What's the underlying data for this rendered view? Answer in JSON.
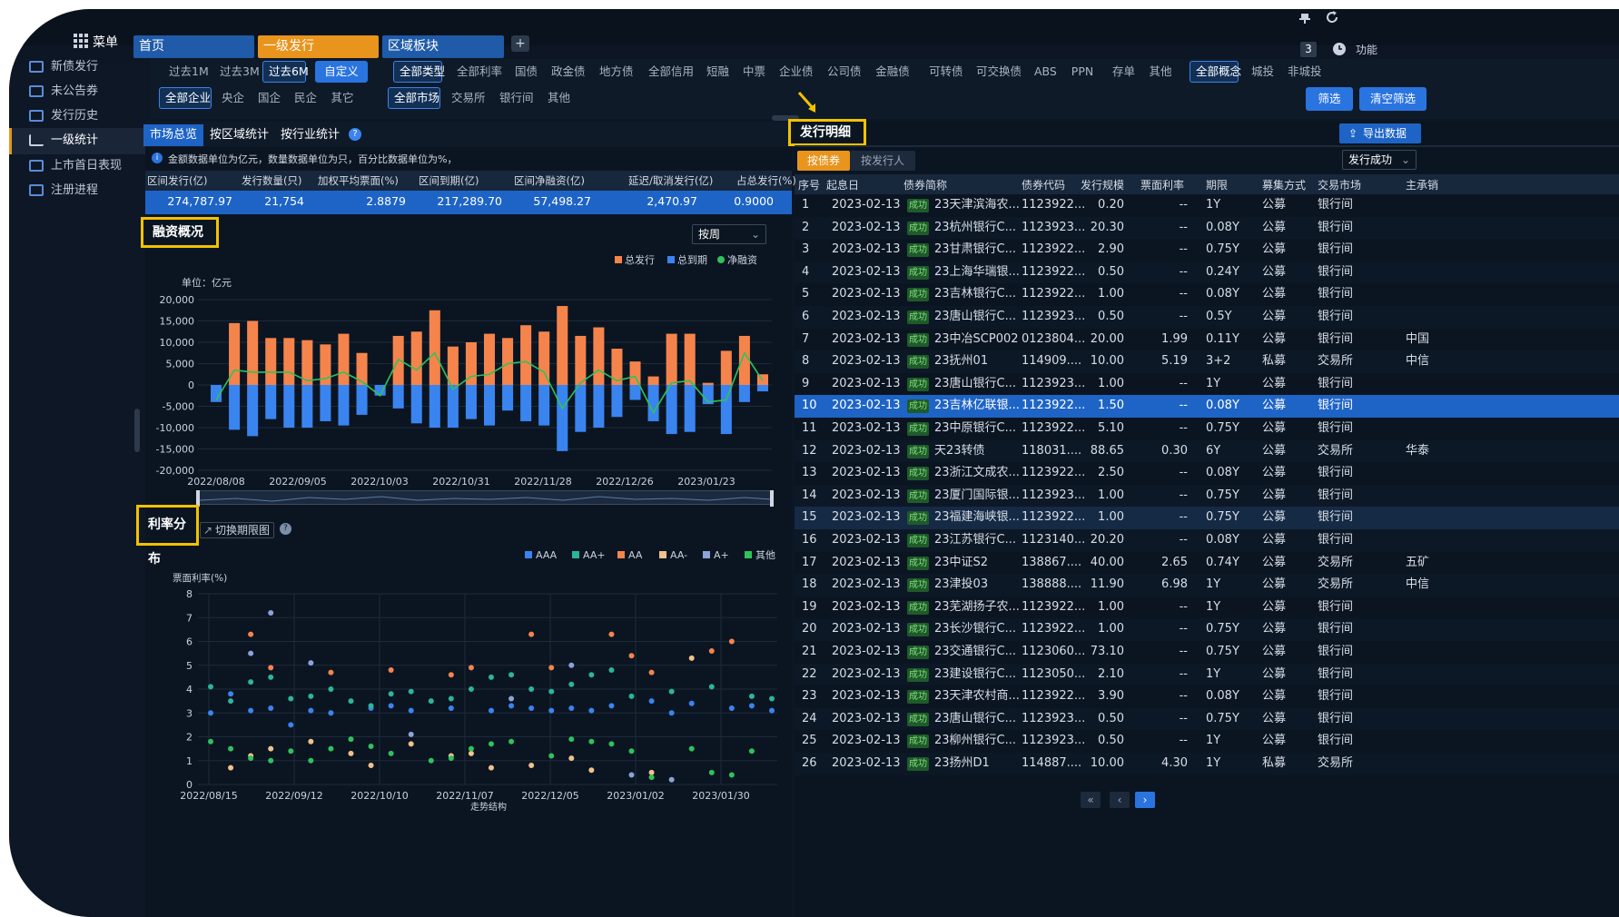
{
  "topbar": {
    "menu_label": "菜单",
    "tabs": [
      "首页",
      "一级发行",
      "区域板块"
    ],
    "add": "+",
    "count": "3",
    "func_label": "功能"
  },
  "sidebar": {
    "items": [
      "新债发行",
      "未公告券",
      "发行历史",
      "一级统计",
      "上市首日表现",
      "注册进程"
    ],
    "active": 3
  },
  "filters": {
    "row1": [
      "过去1M",
      "过去3M",
      "过去6M",
      "自定义",
      "全部类型",
      "全部利率",
      "国债",
      "政金债",
      "地方债",
      "全部信用",
      "短融",
      "中票",
      "企业债",
      "公司债",
      "金融债",
      "可转债",
      "可交换债",
      "ABS",
      "PPN",
      "存单",
      "其他",
      "全部概念",
      "城投",
      "非城投"
    ],
    "row2": [
      "全部企业",
      "央企",
      "国企",
      "民企",
      "其它",
      "全部市场",
      "交易所",
      "银行间",
      "其他"
    ],
    "screen_button": "筛选",
    "clear_button": "清空筛选"
  },
  "left": {
    "tabs": [
      "市场总览",
      "按区域统计",
      "按行业统计"
    ],
    "notice": "金额数据单位为亿元，数量数据单位为只，百分比数据单位为%，",
    "summary_headers": [
      "区间发行(亿)",
      "发行数量(只)",
      "加权平均票面(%)",
      "区间到期(亿)",
      "区间净融资(亿)",
      "延迟/取消发行(亿)",
      "占总发行(%)"
    ],
    "summary_values": [
      "274,787.97",
      "21,754",
      "2.8879",
      "217,289.70",
      "57,498.27",
      "2,470.97",
      "0.9000"
    ],
    "financing_title": "融资概况",
    "period_select": "按周",
    "rate_title": "利率分布",
    "switch_term": "切换期限图"
  },
  "chart_data": [
    {
      "type": "bar",
      "title": "",
      "unit": "单位：亿元",
      "legend": [
        "总发行",
        "总到期",
        "净融资"
      ],
      "colors": {
        "总发行": "#f5844c",
        "总到期": "#3a84f0",
        "净融资": "#2fc25b"
      },
      "x_ticks": [
        "2022/08/08",
        "2022/09/05",
        "2022/10/03",
        "2022/10/31",
        "2022/11/28",
        "2022/12/26",
        "2023/01/23"
      ],
      "ylim": [
        -20000,
        20000
      ],
      "y_ticks": [
        "20,000",
        "15,000",
        "10,000",
        "5,000",
        "0",
        "-5,000",
        "-10,000",
        "-15,000",
        "-20,000"
      ],
      "series": [
        {
          "name": "总发行",
          "values": [
            0,
            14500,
            15000,
            11000,
            11000,
            10500,
            9500,
            12000,
            7500,
            0,
            11500,
            12500,
            17500,
            9000,
            10000,
            12000,
            11000,
            14000,
            12500,
            18500,
            11500,
            13500,
            8500,
            5500,
            2000,
            12000,
            12000,
            500,
            8000,
            11500,
            2500
          ]
        },
        {
          "name": "总到期",
          "values": [
            -4000,
            -10500,
            -12000,
            -8000,
            -10000,
            -10000,
            -8500,
            -9500,
            -7000,
            -2500,
            -5500,
            -9000,
            -10000,
            -10000,
            -8000,
            -9500,
            -6000,
            -8500,
            -9500,
            -15500,
            -11000,
            -10000,
            -7500,
            -3500,
            -8500,
            -11500,
            -11000,
            -4500,
            -11500,
            -4000,
            -1500
          ]
        },
        {
          "name": "净融资",
          "values": [
            -3500,
            3500,
            3000,
            3000,
            3000,
            1000,
            1500,
            3000,
            800,
            -2500,
            6000,
            3500,
            7500,
            -1000,
            2000,
            2500,
            5000,
            5500,
            3000,
            -5500,
            500,
            3500,
            1000,
            2000,
            -6500,
            500,
            1000,
            -4000,
            -3500,
            7500,
            1000
          ]
        }
      ]
    },
    {
      "type": "scatter",
      "ylabel": "票面利率(%)",
      "xlabel": "走势结构",
      "x_ticks": [
        "2022/08/15",
        "2022/09/12",
        "2022/10/10",
        "2022/11/07",
        "2022/12/05",
        "2023/01/02",
        "2023/01/30"
      ],
      "ylim": [
        0,
        8
      ],
      "legend": [
        "AAA",
        "AA+",
        "AA",
        "AA-",
        "A+",
        "其他"
      ],
      "colors": {
        "AAA": "#3a84f0",
        "AA+": "#2bb59c",
        "AA": "#f5844c",
        "AA-": "#f0c28c",
        "A+": "#8aa3d8",
        "其他": "#2fc25b"
      },
      "series": [
        {
          "name": "AAA",
          "points": [
            [
              0,
              3
            ],
            [
              1,
              3.8
            ],
            [
              2,
              3.1
            ],
            [
              3,
              3.2
            ],
            [
              4,
              2.5
            ],
            [
              5,
              3.1
            ],
            [
              6,
              3
            ],
            [
              8,
              3.2
            ],
            [
              9,
              3.3
            ],
            [
              10,
              3.1
            ],
            [
              12,
              3.2
            ],
            [
              14,
              3.1
            ],
            [
              15,
              3.3
            ],
            [
              16,
              3.2
            ],
            [
              17,
              3.1
            ],
            [
              18,
              3.2
            ],
            [
              19,
              3.1
            ],
            [
              20,
              3.3
            ],
            [
              22,
              3.5
            ],
            [
              23,
              3
            ],
            [
              24,
              3.4
            ],
            [
              26,
              3.2
            ],
            [
              27,
              3.3
            ],
            [
              28,
              3.1
            ]
          ]
        },
        {
          "name": "AA+",
          "points": [
            [
              0,
              4.1
            ],
            [
              1,
              3.5
            ],
            [
              2,
              4.3
            ],
            [
              3,
              4.5
            ],
            [
              4,
              3.6
            ],
            [
              5,
              3.7
            ],
            [
              6,
              4
            ],
            [
              7,
              3.5
            ],
            [
              8,
              3.3
            ],
            [
              9,
              3.8
            ],
            [
              10,
              3.9
            ],
            [
              11,
              3.5
            ],
            [
              12,
              3.6
            ],
            [
              13,
              4
            ],
            [
              14,
              4.5
            ],
            [
              15,
              4.6
            ],
            [
              16,
              4
            ],
            [
              17,
              3.9
            ],
            [
              18,
              4.2
            ],
            [
              19,
              4.6
            ],
            [
              20,
              4.8
            ],
            [
              21,
              3.7
            ],
            [
              23,
              3.9
            ],
            [
              25,
              4.1
            ],
            [
              27,
              3.7
            ],
            [
              28,
              3.6
            ]
          ]
        },
        {
          "name": "AA",
          "points": [
            [
              2,
              6.3
            ],
            [
              3,
              4.9
            ],
            [
              6,
              4.7
            ],
            [
              9,
              4.8
            ],
            [
              12,
              4.6
            ],
            [
              13,
              4.9
            ],
            [
              16,
              6.3
            ],
            [
              17,
              4.9
            ],
            [
              20,
              6.3
            ],
            [
              21,
              5.4
            ],
            [
              22,
              4.7
            ],
            [
              25,
              5.6
            ],
            [
              26,
              6
            ]
          ]
        },
        {
          "name": "AA-",
          "points": [
            [
              1,
              0.7
            ],
            [
              2,
              1.2
            ],
            [
              3,
              1.5
            ],
            [
              5,
              1.8
            ],
            [
              7,
              1.3
            ],
            [
              8,
              0.8
            ],
            [
              10,
              1.7
            ],
            [
              12,
              1.2
            ],
            [
              13,
              1.3
            ],
            [
              14,
              0.7
            ],
            [
              16,
              0.8
            ],
            [
              18,
              1.1
            ],
            [
              19,
              0.6
            ],
            [
              22,
              0.5
            ],
            [
              24,
              5.3
            ]
          ]
        },
        {
          "name": "A+",
          "points": [
            [
              2,
              5.5
            ],
            [
              3,
              7.2
            ],
            [
              5,
              5.1
            ],
            [
              10,
              2.1
            ],
            [
              15,
              3.6
            ],
            [
              18,
              5
            ],
            [
              21,
              0.4
            ],
            [
              23,
              0.2
            ]
          ]
        },
        {
          "name": "其他",
          "points": [
            [
              0,
              1.8
            ],
            [
              1,
              1.5
            ],
            [
              2,
              1.1
            ],
            [
              3,
              1.0
            ],
            [
              4,
              1.4
            ],
            [
              5,
              1.0
            ],
            [
              6,
              1.5
            ],
            [
              7,
              1.9
            ],
            [
              8,
              1.6
            ],
            [
              9,
              1.3
            ],
            [
              11,
              1.0
            ],
            [
              12,
              1.1
            ],
            [
              13,
              1.5
            ],
            [
              14,
              1.7
            ],
            [
              15,
              1.8
            ],
            [
              17,
              1.2
            ],
            [
              18,
              1.9
            ],
            [
              19,
              1.8
            ],
            [
              20,
              1.7
            ],
            [
              21,
              1.4
            ],
            [
              22,
              0.3
            ],
            [
              24,
              1.5
            ],
            [
              25,
              0.5
            ],
            [
              26,
              0.4
            ],
            [
              27,
              1.4
            ]
          ]
        }
      ]
    }
  ],
  "right": {
    "detail_title": "发行明细",
    "export_button": "导出数据",
    "subtabs": [
      "按债券",
      "按发行人"
    ],
    "status_select": "发行成功",
    "headers": [
      "序号",
      "起息日",
      "债券简称",
      "债券代码",
      "发行规模",
      "票面利率",
      "期限",
      "募集方式",
      "交易市场",
      "主承销"
    ],
    "status_label": "成功",
    "selected_row": 10,
    "rows": [
      [
        "1",
        "2023-02-13",
        "23天津滨海农...",
        "1123922...",
        "0.20",
        "--",
        "1Y",
        "公募",
        "银行间",
        ""
      ],
      [
        "2",
        "2023-02-13",
        "23杭州银行C...",
        "1123923...",
        "20.30",
        "--",
        "0.08Y",
        "公募",
        "银行间",
        ""
      ],
      [
        "3",
        "2023-02-13",
        "23甘肃银行C...",
        "1123922...",
        "2.90",
        "--",
        "0.75Y",
        "公募",
        "银行间",
        ""
      ],
      [
        "4",
        "2023-02-13",
        "23上海华瑞银...",
        "1123922...",
        "0.50",
        "--",
        "0.24Y",
        "公募",
        "银行间",
        ""
      ],
      [
        "5",
        "2023-02-13",
        "23吉林银行C...",
        "1123922...",
        "1.00",
        "--",
        "0.08Y",
        "公募",
        "银行间",
        ""
      ],
      [
        "6",
        "2023-02-13",
        "23唐山银行C...",
        "1123923...",
        "0.50",
        "--",
        "0.5Y",
        "公募",
        "银行间",
        ""
      ],
      [
        "7",
        "2023-02-13",
        "23中冶SCP002",
        "0123804...",
        "20.00",
        "1.99",
        "0.11Y",
        "公募",
        "银行间",
        "中国"
      ],
      [
        "8",
        "2023-02-13",
        "23抚州01",
        "114909....",
        "10.00",
        "5.19",
        "3+2",
        "私募",
        "交易所",
        "中信"
      ],
      [
        "9",
        "2023-02-13",
        "23唐山银行C...",
        "1123923...",
        "1.00",
        "--",
        "1Y",
        "公募",
        "银行间",
        ""
      ],
      [
        "10",
        "2023-02-13",
        "23吉林亿联银...",
        "1123922...",
        "1.50",
        "--",
        "0.08Y",
        "公募",
        "银行间",
        ""
      ],
      [
        "11",
        "2023-02-13",
        "23中原银行C...",
        "1123922...",
        "5.10",
        "--",
        "0.75Y",
        "公募",
        "银行间",
        ""
      ],
      [
        "12",
        "2023-02-13",
        "天23转债",
        "118031....",
        "88.65",
        "0.30",
        "6Y",
        "公募",
        "交易所",
        "华泰"
      ],
      [
        "13",
        "2023-02-13",
        "23浙江文成农...",
        "1123922...",
        "2.50",
        "--",
        "0.08Y",
        "公募",
        "银行间",
        ""
      ],
      [
        "14",
        "2023-02-13",
        "23厦门国际银...",
        "1123923...",
        "1.00",
        "--",
        "0.75Y",
        "公募",
        "银行间",
        ""
      ],
      [
        "15",
        "2023-02-13",
        "23福建海峡银...",
        "1123922...",
        "1.00",
        "--",
        "0.75Y",
        "公募",
        "银行间",
        ""
      ],
      [
        "16",
        "2023-02-13",
        "23江苏银行C...",
        "1123140...",
        "20.20",
        "--",
        "0.08Y",
        "公募",
        "银行间",
        ""
      ],
      [
        "17",
        "2023-02-13",
        "23中证S2",
        "138867....",
        "40.00",
        "2.65",
        "0.74Y",
        "公募",
        "交易所",
        "五矿"
      ],
      [
        "18",
        "2023-02-13",
        "23津投03",
        "138888....",
        "11.90",
        "6.98",
        "1Y",
        "公募",
        "交易所",
        "中信"
      ],
      [
        "19",
        "2023-02-13",
        "23芜湖扬子农...",
        "1123922...",
        "1.00",
        "--",
        "1Y",
        "公募",
        "银行间",
        ""
      ],
      [
        "20",
        "2023-02-13",
        "23长沙银行C...",
        "1123922...",
        "1.00",
        "--",
        "0.75Y",
        "公募",
        "银行间",
        ""
      ],
      [
        "21",
        "2023-02-13",
        "23交通银行C...",
        "1123060...",
        "73.10",
        "--",
        "0.75Y",
        "公募",
        "银行间",
        ""
      ],
      [
        "22",
        "2023-02-13",
        "23建设银行C...",
        "1123050...",
        "2.10",
        "--",
        "1Y",
        "公募",
        "银行间",
        ""
      ],
      [
        "23",
        "2023-02-13",
        "23天津农村商...",
        "1123922...",
        "3.90",
        "--",
        "0.08Y",
        "公募",
        "银行间",
        ""
      ],
      [
        "24",
        "2023-02-13",
        "23唐山银行C...",
        "1123923...",
        "0.50",
        "--",
        "0.75Y",
        "公募",
        "银行间",
        ""
      ],
      [
        "25",
        "2023-02-13",
        "23柳州银行C...",
        "1123923...",
        "0.50",
        "--",
        "1Y",
        "公募",
        "银行间",
        ""
      ],
      [
        "26",
        "2023-02-13",
        "23扬州D1",
        "114887....",
        "10.00",
        "4.30",
        "1Y",
        "私募",
        "交易所",
        ""
      ]
    ],
    "pager": [
      "«",
      "‹",
      "›"
    ]
  }
}
